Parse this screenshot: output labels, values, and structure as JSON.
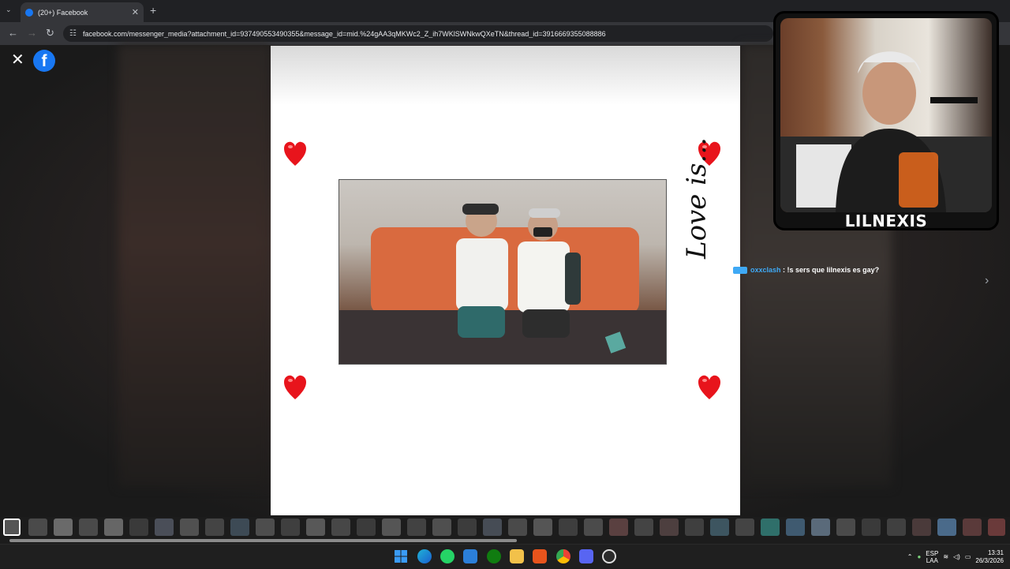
{
  "browser": {
    "tab_title": "(20+) Facebook",
    "url": "facebook.com/messenger_media?attachment_id=937490553490355&message_id=mid.%24gAA3qMKWc2_Z_ih7WKlSWNkwQXeTN&thread_id=3916669355088886"
  },
  "viewer": {
    "card_caption": "Love is..."
  },
  "stream": {
    "streamer_name": "LILNEXIS",
    "chat_user": "oxxclash",
    "chat_separator": " : ",
    "chat_message": "!s sers que lilnexis es gay?"
  },
  "taskbar": {
    "lang_primary": "ESP",
    "lang_secondary": "LAA",
    "time": "13:31",
    "date": "26/3/2026"
  },
  "colors": {
    "facebook_blue": "#1877f2",
    "heart_red": "#e8141c",
    "chat_user": "#3fa9f5"
  },
  "icons": [
    "close-icon",
    "facebook-logo",
    "heart-icon",
    "chevron-right-icon",
    "back-icon",
    "forward-icon",
    "reload-icon",
    "windows-start-icon",
    "edge-icon",
    "whatsapp-icon",
    "store-icon",
    "xbox-icon",
    "files-icon",
    "brave-icon",
    "chrome-icon",
    "discord-icon",
    "obs-icon",
    "wifi-icon",
    "volume-icon",
    "mic-icon"
  ]
}
